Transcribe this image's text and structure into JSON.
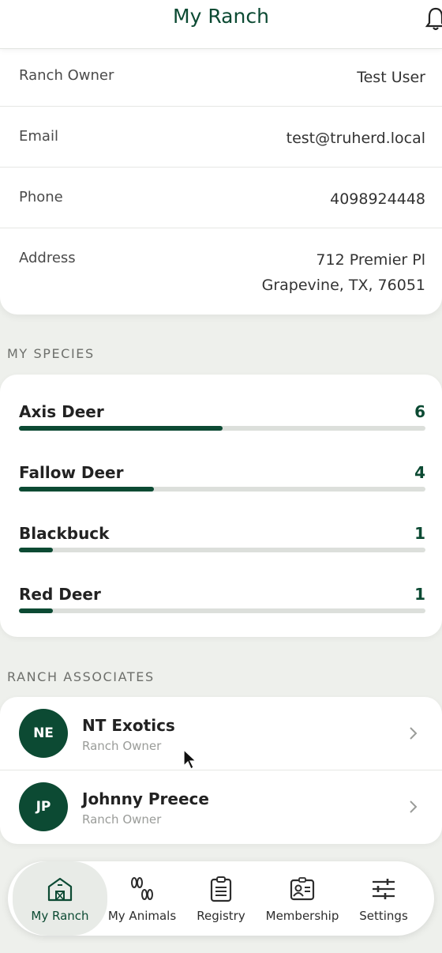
{
  "header": {
    "title": "My Ranch",
    "bell_icon": "bell-icon"
  },
  "ranch_info": [
    {
      "label": "Ranch Owner",
      "value": "Test User"
    },
    {
      "label": "Email",
      "value": "test@truherd.local"
    },
    {
      "label": "Phone",
      "value": "4098924448"
    },
    {
      "label": "Address",
      "value_line1": "712 Premier Pl",
      "value_line2": "Grapevine, TX, 76051"
    }
  ],
  "species_section": {
    "title": "MY SPECIES",
    "items": [
      {
        "name": "Axis Deer",
        "count": "6",
        "progress": 0.5
      },
      {
        "name": "Fallow Deer",
        "count": "4",
        "progress": 0.333
      },
      {
        "name": "Blackbuck",
        "count": "1",
        "progress": 0.083
      },
      {
        "name": "Red Deer",
        "count": "1",
        "progress": 0.083
      }
    ]
  },
  "associates_section": {
    "title": "RANCH ASSOCIATES",
    "items": [
      {
        "initials": "NE",
        "name": "NT Exotics",
        "role": "Ranch Owner"
      },
      {
        "initials": "JP",
        "name": "Johnny Preece",
        "role": "Ranch Owner"
      }
    ]
  },
  "tabs": [
    {
      "label": "My Ranch",
      "icon": "barn-icon",
      "active": true
    },
    {
      "label": "My Animals",
      "icon": "hoof-prints-icon",
      "active": false
    },
    {
      "label": "Registry",
      "icon": "clipboard-icon",
      "active": false
    },
    {
      "label": "Membership",
      "icon": "id-card-icon",
      "active": false
    },
    {
      "label": "Settings",
      "icon": "sliders-icon",
      "active": false
    }
  ],
  "colors": {
    "accent": "#0c4a33",
    "background": "#eef0ec",
    "track": "#dcdfdb"
  }
}
